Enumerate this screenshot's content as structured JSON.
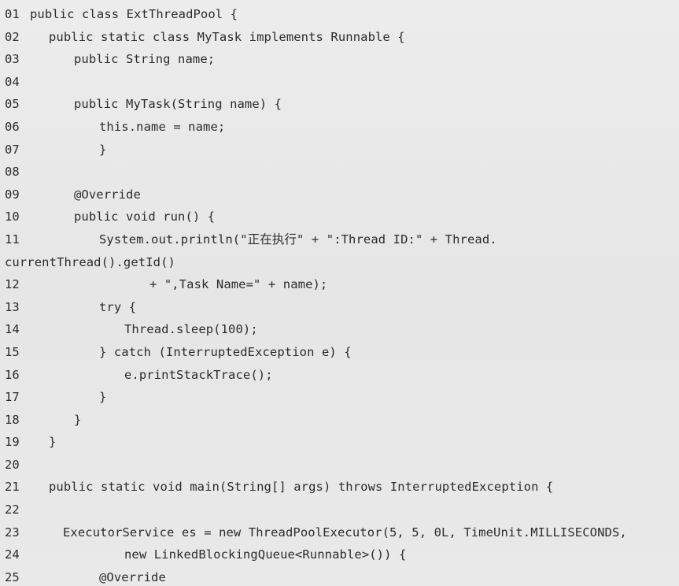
{
  "lines": [
    {
      "no": "01",
      "text": "public class ExtThreadPool {"
    },
    {
      "no": "02",
      "text": "public static class MyTask implements Runnable {"
    },
    {
      "no": "03",
      "text": "public String name;"
    },
    {
      "no": "04",
      "text": ""
    },
    {
      "no": "05",
      "text": "public MyTask(String name) {"
    },
    {
      "no": "06",
      "text": "this.name = name;"
    },
    {
      "no": "07",
      "text": "}"
    },
    {
      "no": "08",
      "text": ""
    },
    {
      "no": "09",
      "text": "@Override"
    },
    {
      "no": "10",
      "text": "public void run() {"
    },
    {
      "no": "11",
      "text": "System.out.println(\"正在执行\" + \":Thread ID:\" + Thread."
    },
    {
      "no": "",
      "text": "currentThread().getId()"
    },
    {
      "no": "12",
      "text": "+ \",Task Name=\" + name);"
    },
    {
      "no": "13",
      "text": "try {"
    },
    {
      "no": "14",
      "text": "Thread.sleep(100);"
    },
    {
      "no": "15",
      "text": "} catch (InterruptedException e) {"
    },
    {
      "no": "16",
      "text": "e.printStackTrace();"
    },
    {
      "no": "17",
      "text": "}"
    },
    {
      "no": "18",
      "text": "}"
    },
    {
      "no": "19",
      "text": "}"
    },
    {
      "no": "20",
      "text": ""
    },
    {
      "no": "21",
      "text": "public static void main(String[] args) throws InterruptedException {"
    },
    {
      "no": "22",
      "text": ""
    },
    {
      "no": "23",
      "text": "ExecutorService es = new ThreadPoolExecutor(5, 5, 0L, TimeUnit.MILLISECONDS,"
    },
    {
      "no": "24",
      "text": "new LinkedBlockingQueue<Runnable>()) {"
    },
    {
      "no": "25",
      "text": "@Override"
    }
  ]
}
